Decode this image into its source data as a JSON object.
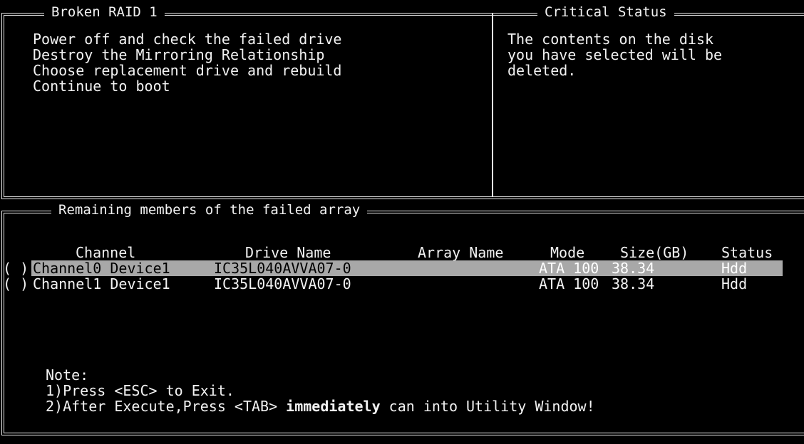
{
  "broken_raid": {
    "title": "Broken RAID 1",
    "options": [
      "Power off and check the failed drive",
      "Destroy the Mirroring Relationship",
      "Choose replacement drive and rebuild",
      "Continue to boot"
    ]
  },
  "critical_status": {
    "title": "Critical Status",
    "lines": [
      "The contents on the disk",
      "you have selected will be",
      "deleted."
    ]
  },
  "remaining": {
    "title": "Remaining members of the failed array",
    "columns": [
      "Channel",
      "Drive Name",
      "Array Name",
      "Mode",
      "Size(GB)",
      "Status"
    ],
    "rows": [
      {
        "radio": "( )",
        "channel": "Channel0 Device1",
        "drive_name": "IC35L040AVVA07-0",
        "array_name": "",
        "mode": "ATA 100",
        "size": "38.34",
        "status": "Hdd",
        "selected": true
      },
      {
        "radio": "( )",
        "channel": "Channel1 Device1",
        "drive_name": "IC35L040AVVA07-0",
        "array_name": "",
        "mode": "ATA 100",
        "size": "38.34",
        "status": "Hdd",
        "selected": false
      }
    ]
  },
  "note": {
    "heading": "Note:",
    "line1": "1)Press <ESC> to Exit.",
    "line2_prefix": "2)After Execute,Press <TAB> ",
    "line2_bold": "immediately",
    "line2_suffix": " can into Utility Window!"
  },
  "colors": {
    "background": "#000000",
    "text": "#f2f2f2",
    "highlight": "#a8a8a8"
  }
}
